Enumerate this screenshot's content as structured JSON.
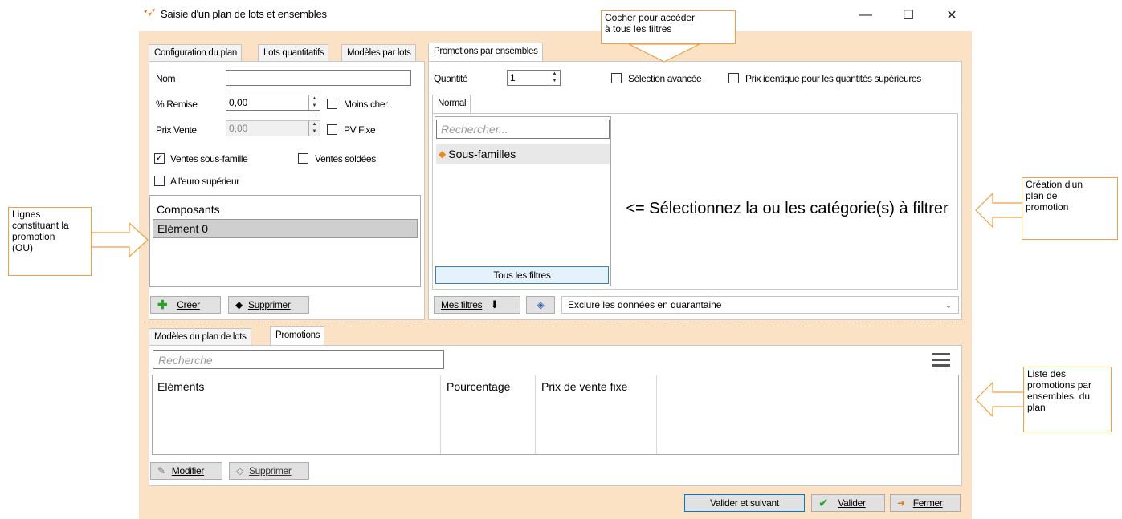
{
  "window": {
    "title": "Saisie d'un plan de lots et ensembles",
    "minimize": "—",
    "maximize": "☐",
    "close": "✕"
  },
  "tabs_top": [
    "Configuration du plan",
    "Lots quantitatifs",
    "Modèles par lots",
    "Promotions par ensembles"
  ],
  "config": {
    "nom_label": "Nom",
    "nom_value": "",
    "remise_label": "% Remise",
    "remise_value": "0,00",
    "prix_label": "Prix Vente",
    "prix_value": "0,00",
    "moins_cher": "Moins cher",
    "pv_fixe": "PV Fixe",
    "ventes_sous_famille": "Ventes sous-famille",
    "ventes_soldees": "Ventes soldées",
    "euro_superieur": "A l'euro supérieur",
    "composants_header": "Composants",
    "composants_items": [
      "Elément 0"
    ],
    "creer": "Créer",
    "supprimer": "Supprimer"
  },
  "promotions": {
    "quantite_label": "Quantité",
    "quantite_value": "1",
    "selection_avancee": "Sélection avancée",
    "prix_identique": "Prix identique pour les quantités supérieures",
    "subtab": "Normal",
    "search_placeholder": "Rechercher...",
    "tree_item": "Sous-familles",
    "tous_filtres": "Tous les filtres",
    "message": "<= Sélectionnez la ou les catégorie(s) à filtrer",
    "mes_filtres": "Mes filtres",
    "exclure": "Exclure les données en quarantaine"
  },
  "bottom": {
    "tabs": [
      "Modèles du plan de lots",
      "Promotions"
    ],
    "search_placeholder": "Recherche",
    "columns": [
      "Eléments",
      "Pourcentage",
      "Prix de vente fixe"
    ],
    "modifier": "Modifier",
    "supprimer": "Supprimer"
  },
  "footer": {
    "valider_suivant": "Valider et suivant",
    "valider": "Valider",
    "fermer": "Fermer"
  },
  "annotations": {
    "filtres": "Cocher pour accéder\nà tous les filtres",
    "creation": "Création d'un\nplan de\npromotion",
    "lignes": "Lignes\nconstituant la\npromotion\n(OU)",
    "liste": "Liste des\npromotions par\nensembles  du\nplan"
  },
  "colors": {
    "frame": "#fbe2c5",
    "annot_border": "#f0a040",
    "logo": "#e8651e"
  }
}
